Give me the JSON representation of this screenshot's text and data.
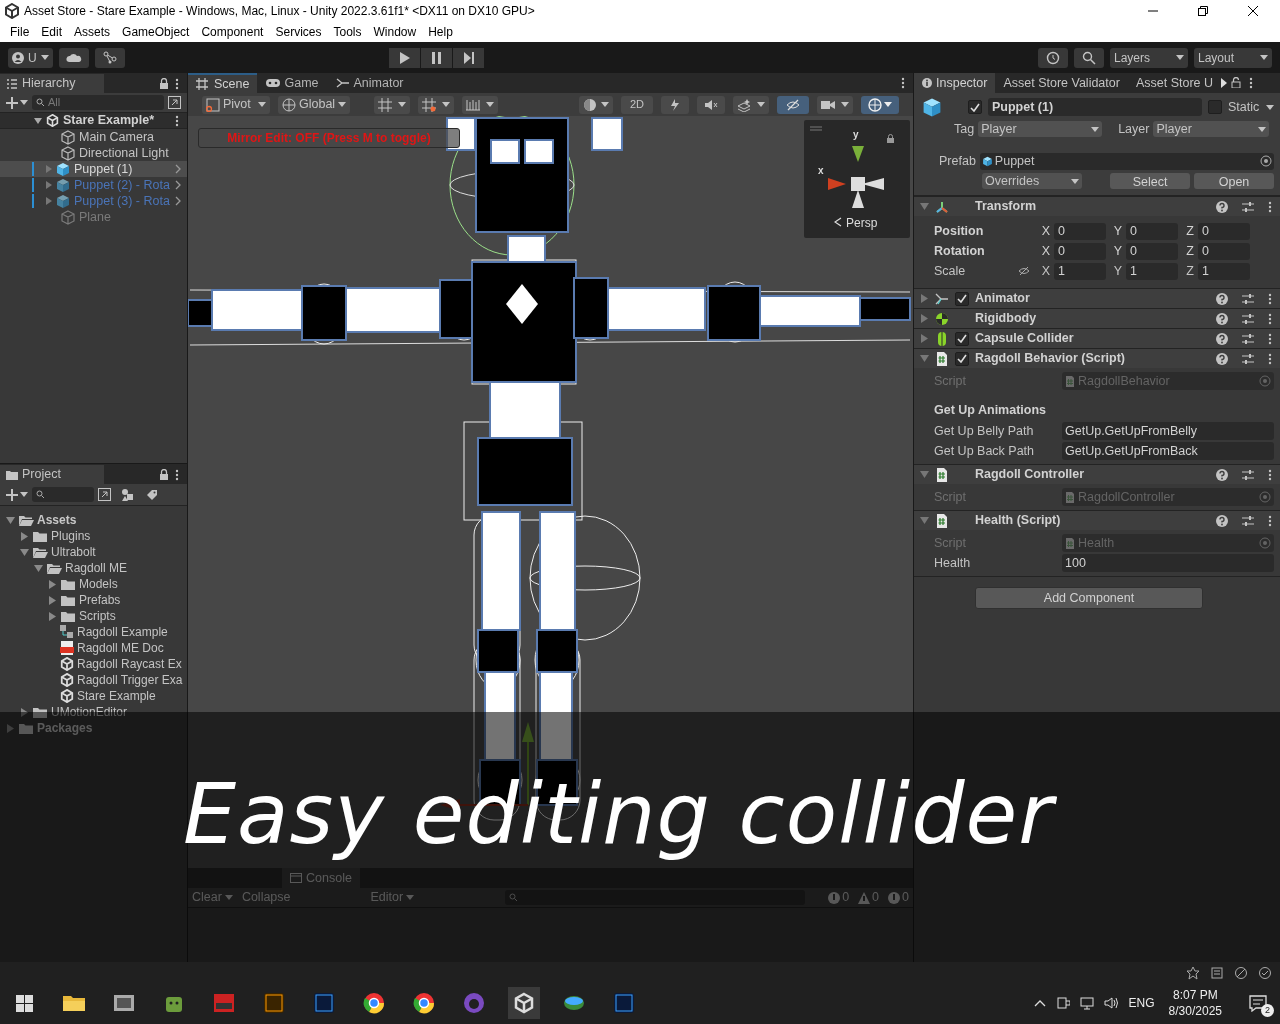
{
  "window": {
    "title": "Asset Store - Stare Example - Windows, Mac, Linux - Unity 2022.3.61f1* <DX11 on DX10 GPU>"
  },
  "menu": [
    "File",
    "Edit",
    "Assets",
    "GameObject",
    "Component",
    "Services",
    "Tools",
    "Window",
    "Help"
  ],
  "toolbar": {
    "account": "U",
    "layers": "Layers",
    "layout": "Layout"
  },
  "hierarchy": {
    "title": "Hierarchy",
    "search_placeholder": "All",
    "scene": "Stare Example*",
    "items": [
      {
        "label": "Main Camera",
        "kind": "object",
        "selected": false
      },
      {
        "label": "Directional Light",
        "kind": "object",
        "selected": false
      },
      {
        "label": "Puppet (1)",
        "kind": "prefab",
        "selected": true
      },
      {
        "label": "Puppet (2) - Rota",
        "kind": "prefab",
        "selected": false
      },
      {
        "label": "Puppet (3) - Rota",
        "kind": "prefab",
        "selected": false
      },
      {
        "label": "Plane",
        "kind": "inactive",
        "selected": false
      }
    ]
  },
  "project": {
    "title": "Project",
    "tree": [
      {
        "label": "Assets",
        "kind": "folder",
        "expanded": true,
        "children": [
          {
            "label": "Plugins",
            "kind": "folder",
            "expanded": false
          },
          {
            "label": "Ultrabolt",
            "kind": "folder",
            "expanded": true,
            "children": [
              {
                "label": "Ragdoll ME",
                "kind": "folder",
                "expanded": true,
                "children": [
                  {
                    "label": "Models",
                    "kind": "folder",
                    "expanded": false
                  },
                  {
                    "label": "Prefabs",
                    "kind": "folder",
                    "expanded": false
                  },
                  {
                    "label": "Scripts",
                    "kind": "folder",
                    "expanded": false
                  },
                  {
                    "label": "Ragdoll Example",
                    "kind": "asset"
                  },
                  {
                    "label": "Ragdoll ME Doc",
                    "kind": "pdf"
                  },
                  {
                    "label": "Ragdoll Raycast Ex",
                    "kind": "scene"
                  },
                  {
                    "label": "Ragdoll Trigger Exa",
                    "kind": "scene"
                  },
                  {
                    "label": "Stare Example",
                    "kind": "scene"
                  }
                ]
              }
            ]
          },
          {
            "label": "UMotionEditor",
            "kind": "folder",
            "expanded": false
          }
        ]
      },
      {
        "label": "Packages",
        "kind": "folder",
        "expanded": false
      }
    ]
  },
  "scene": {
    "tabs": [
      {
        "label": "Scene",
        "selected": true
      },
      {
        "label": "Game",
        "selected": false
      },
      {
        "label": "Animator",
        "selected": false
      }
    ],
    "pivot": "Pivot",
    "space": "Global",
    "mode": "2D",
    "notice": "Mirror Edit: OFF (Press M to toggle)",
    "gizmo": {
      "y": "y",
      "x": "x",
      "projection": "Persp"
    }
  },
  "console": {
    "tab": "Console",
    "buttons": [
      "Clear",
      "Collapse",
      "Editor"
    ],
    "counts": [
      "0",
      "0",
      "0"
    ]
  },
  "inspector": {
    "tabs": [
      {
        "label": "Inspector",
        "selected": true
      },
      {
        "label": "Asset Store Validator",
        "selected": false
      },
      {
        "label": "Asset Store U",
        "selected": false
      }
    ],
    "object": {
      "name": "Puppet (1)",
      "active": true,
      "static": false,
      "static_label": "Static",
      "tag_label": "Tag",
      "tag": "Player",
      "layer_label": "Layer",
      "layer": "Player",
      "prefab_label": "Prefab",
      "prefab": "Puppet",
      "overrides": "Overrides",
      "buttons": [
        "Select",
        "Open"
      ]
    },
    "components": [
      {
        "title": "Transform",
        "kind": "transform",
        "expanded": true,
        "rows": [
          {
            "label": "Position",
            "values": [
              {
                "axis": "X",
                "value": "0"
              },
              {
                "axis": "Y",
                "value": "0"
              },
              {
                "axis": "Z",
                "value": "0"
              }
            ]
          },
          {
            "label": "Rotation",
            "values": [
              {
                "axis": "X",
                "value": "0"
              },
              {
                "axis": "Y",
                "value": "0"
              },
              {
                "axis": "Z",
                "value": "0"
              }
            ]
          },
          {
            "label": "Scale",
            "values": [
              {
                "axis": "X",
                "value": "1"
              },
              {
                "axis": "Y",
                "value": "1"
              },
              {
                "axis": "Z",
                "value": "1"
              }
            ]
          }
        ]
      },
      {
        "title": "Animator",
        "kind": "animator",
        "expanded": false,
        "enabled": true
      },
      {
        "title": "Rigidbody",
        "kind": "rigidbody",
        "expanded": false
      },
      {
        "title": "Capsule Collider",
        "kind": "collider",
        "expanded": false,
        "enabled": true
      },
      {
        "title": "Ragdoll Behavior (Script)",
        "kind": "script",
        "expanded": true,
        "enabled": true,
        "fields": [
          {
            "kind": "reference",
            "label": "Script",
            "value": "RagdollBehavior"
          },
          {
            "kind": "header",
            "label": "Get Up Animations"
          },
          {
            "kind": "text",
            "label": "Get Up Belly Path",
            "value": "GetUp.GetUpFromBelly"
          },
          {
            "kind": "text",
            "label": "Get Up Back Path",
            "value": "GetUp.GetUpFromBack"
          }
        ]
      },
      {
        "title": "Ragdoll Controller",
        "kind": "script",
        "expanded": true,
        "fields": [
          {
            "kind": "reference",
            "label": "Script",
            "value": "RagdollController"
          }
        ]
      },
      {
        "title": "Health (Script)",
        "kind": "script",
        "expanded": true,
        "fields": [
          {
            "kind": "reference",
            "label": "Script",
            "value": "Health"
          },
          {
            "kind": "text",
            "label": "Health",
            "value": "100"
          }
        ]
      }
    ],
    "add_button": "Add Component"
  },
  "caption": "Easy editing collider",
  "taskbar": {
    "language": "ENG",
    "time": "8:07 PM",
    "date": "8/30/2025",
    "notifications": "2"
  }
}
